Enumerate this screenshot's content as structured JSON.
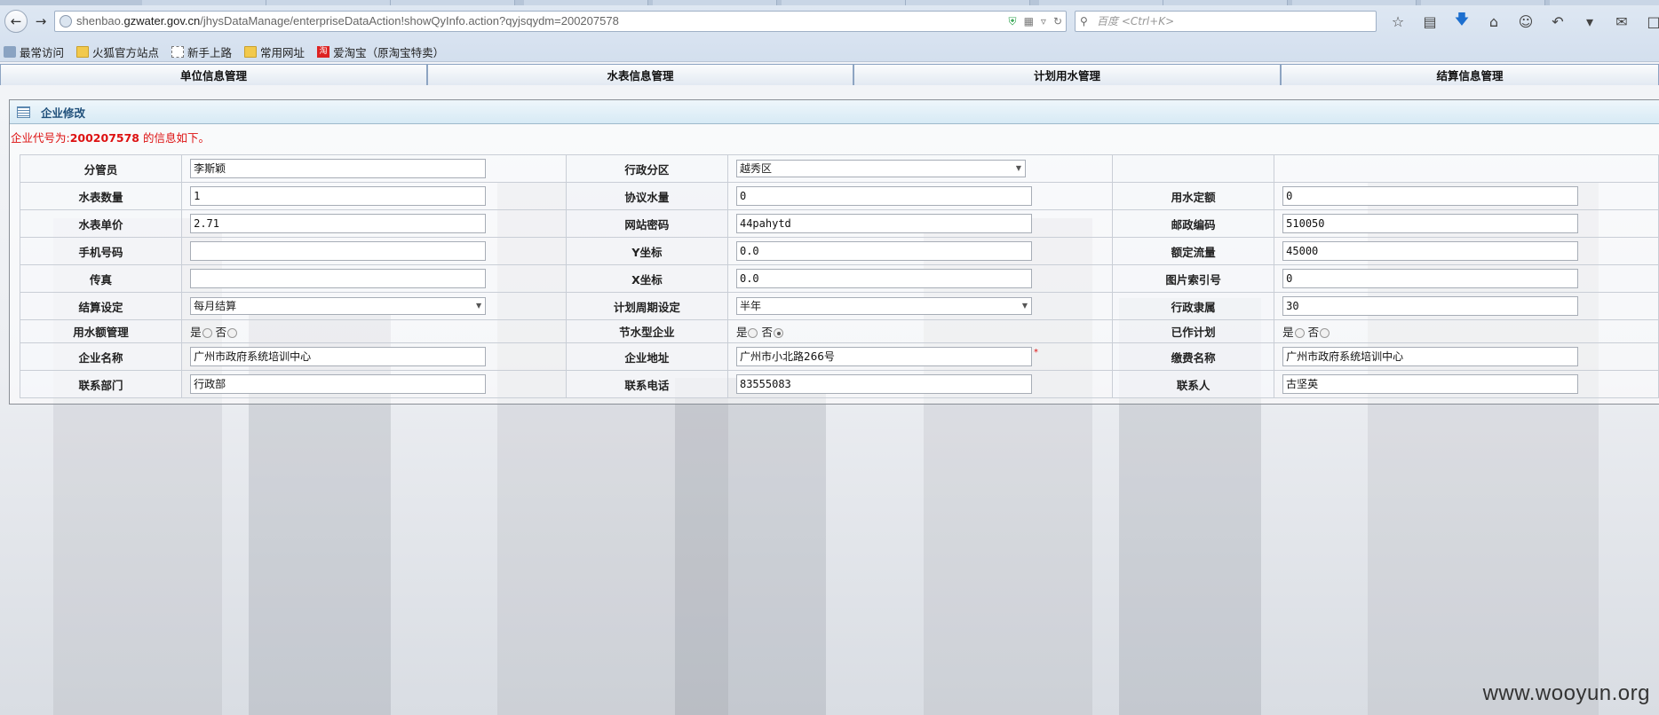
{
  "browser": {
    "url_prefix": "shenbao.",
    "url_host": "gzwater.gov.cn",
    "url_path": "/jhysDataManage/enterpriseDataAction!showQyInfo.action?qyjsqydm=200207578",
    "search_placeholder": "百度 <Ctrl+K>",
    "bookmarks": [
      "最常访问",
      "火狐官方站点",
      "新手上路",
      "常用网址",
      "爱淘宝（原淘宝特卖）"
    ]
  },
  "menu_tabs": [
    "单位信息管理",
    "水表信息管理",
    "计划用水管理",
    "结算信息管理"
  ],
  "panel": {
    "title": "企业修改",
    "notice_prefix": "企业代号为:",
    "notice_code": "200207578",
    "notice_suffix": " 的信息如下。"
  },
  "form": {
    "fenguanyuan": {
      "label": "分管员",
      "value": "李斯颖"
    },
    "xingzhengfenqu": {
      "label": "行政分区",
      "value": "越秀区"
    },
    "shuibiaoshuliang": {
      "label": "水表数量",
      "value": "1"
    },
    "xieyishuiliang": {
      "label": "协议水量",
      "value": "0"
    },
    "yongshuidinge": {
      "label": "用水定额",
      "value": "0"
    },
    "shuibiaodanjia": {
      "label": "水表单价",
      "value": "2.71"
    },
    "wangzhanmima": {
      "label": "网站密码",
      "value": "44pahytd"
    },
    "youzhengbianma": {
      "label": "邮政编码",
      "value": "510050"
    },
    "shoujihaoma": {
      "label": "手机号码",
      "value": ""
    },
    "yzuobiao": {
      "label": "Y坐标",
      "value": "0.0"
    },
    "edingliuliang": {
      "label": "额定流量",
      "value": "45000"
    },
    "chuanzhen": {
      "label": "传真",
      "value": ""
    },
    "xzuobiao": {
      "label": "X坐标",
      "value": "0.0"
    },
    "tupiansuoyin": {
      "label": "图片索引号",
      "value": "0"
    },
    "jiesuansheding": {
      "label": "结算设定",
      "value": "每月结算"
    },
    "jihuazhouqi": {
      "label": "计划周期设定",
      "value": "半年"
    },
    "xingzhenglishu": {
      "label": "行政隶属",
      "value": "30"
    },
    "yongshuiguanli": {
      "label": "用水额管理",
      "yes": "是",
      "no": "否"
    },
    "jieshuixing": {
      "label": "节水型企业",
      "yes": "是",
      "no": "否"
    },
    "yizuojihua": {
      "label": "已作计划",
      "yes": "是",
      "no": "否"
    },
    "qiyemingcheng": {
      "label": "企业名称",
      "value": "广州市政府系统培训中心"
    },
    "qiyedizhi": {
      "label": "企业地址",
      "value": "广州市小北路266号",
      "required": "*"
    },
    "jiaofeimingcheng": {
      "label": "缴费名称",
      "value": "广州市政府系统培训中心"
    },
    "lianxibumen": {
      "label": "联系部门",
      "value": "行政部"
    },
    "lianxidianhua": {
      "label": "联系电话",
      "value": "83555083"
    },
    "lianxiren": {
      "label": "联系人",
      "value": "古坚英"
    }
  },
  "watermark": "www.wooyun.org"
}
